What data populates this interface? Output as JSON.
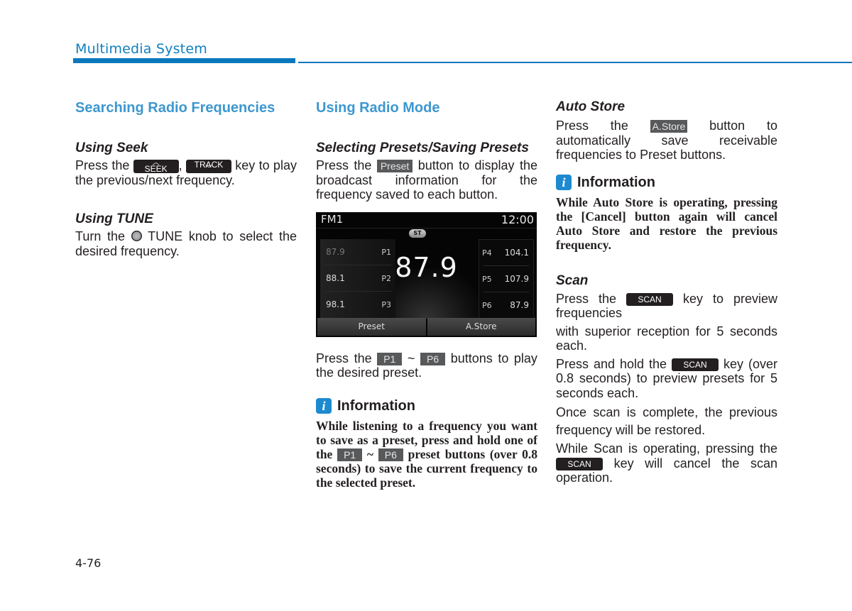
{
  "header": {
    "title": "Multimedia System",
    "accent_color": "#0b78be"
  },
  "page_number": "4-76",
  "col1": {
    "section_title": "Searching Radio Frequencies",
    "seek": {
      "title": "Using Seek",
      "text_before": "Press the",
      "key1": "SEEK",
      "sep": ",",
      "key2": "TRACK",
      "text_after": "key to play the previous/next frequency."
    },
    "tune": {
      "title": "Using TUNE",
      "text_before": "Turn the",
      "text_after": "TUNE knob to select the desired frequency."
    }
  },
  "col2": {
    "section_title": "Using Radio Mode",
    "presets": {
      "title": "Selecting Presets/Saving Presets",
      "text_before": "Press the",
      "key": "Preset",
      "text_after": "button to display the broadcast information for the frequency saved to each button."
    },
    "screen": {
      "band": "FM1",
      "clock": "12:00",
      "stereo": "ST",
      "frequency": "87.9",
      "left_presets": [
        {
          "freq": "87.9",
          "label": "P1"
        },
        {
          "freq": "88.1",
          "label": "P2"
        },
        {
          "freq": "98.1",
          "label": "P3"
        }
      ],
      "right_presets": [
        {
          "label": "P4",
          "freq": "104.1"
        },
        {
          "label": "P5",
          "freq": "107.9"
        },
        {
          "label": "P6",
          "freq": "87.9"
        }
      ],
      "buttons": [
        "Preset",
        "A.Store"
      ]
    },
    "play": {
      "text_before": "Press the",
      "key1": "P1",
      "tilde": "~",
      "key2": "P6",
      "text_after": "buttons to play the desired preset."
    },
    "info": {
      "label": "Information",
      "text_before": "While listening to a frequency you want to save as a preset, press and hold one of the",
      "key1": "P1",
      "tilde": "~",
      "key2": "P6",
      "text_after": "preset buttons (over 0.8 seconds) to save the current frequency to the selected preset."
    }
  },
  "col3": {
    "autostore": {
      "title": "Auto Store",
      "text_before": "Press the",
      "key": "A.Store",
      "text_after": "button to automatically save receivable frequencies to Preset buttons."
    },
    "info": {
      "label": "Information",
      "text": "While Auto Store is operating, pressing the [Cancel] button again will cancel Auto Store and restore the previous frequency."
    },
    "scan": {
      "title": "Scan",
      "p1_before": "Press the",
      "key": "SCAN",
      "p1_after": "key to preview frequencies",
      "p2": "with superior reception for 5 seconds each.",
      "p3_before": "Press and hold the",
      "p3_after": "key (over 0.8 seconds) to preview presets for 5 seconds each.",
      "p4": "Once scan is complete, the previous frequency will be restored.",
      "p5_before": "While Scan is operating, pressing the",
      "p5_after": "key will cancel the scan operation."
    }
  }
}
